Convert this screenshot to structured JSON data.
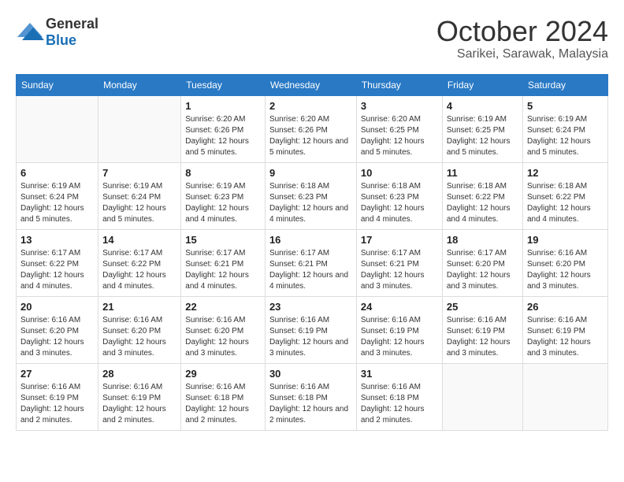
{
  "header": {
    "logo_general": "General",
    "logo_blue": "Blue",
    "month_year": "October 2024",
    "location": "Sarikei, Sarawak, Malaysia"
  },
  "days_of_week": [
    "Sunday",
    "Monday",
    "Tuesday",
    "Wednesday",
    "Thursday",
    "Friday",
    "Saturday"
  ],
  "weeks": [
    [
      null,
      null,
      {
        "day": 1,
        "sunrise": "Sunrise: 6:20 AM",
        "sunset": "Sunset: 6:26 PM",
        "daylight": "Daylight: 12 hours and 5 minutes."
      },
      {
        "day": 2,
        "sunrise": "Sunrise: 6:20 AM",
        "sunset": "Sunset: 6:26 PM",
        "daylight": "Daylight: 12 hours and 5 minutes."
      },
      {
        "day": 3,
        "sunrise": "Sunrise: 6:20 AM",
        "sunset": "Sunset: 6:25 PM",
        "daylight": "Daylight: 12 hours and 5 minutes."
      },
      {
        "day": 4,
        "sunrise": "Sunrise: 6:19 AM",
        "sunset": "Sunset: 6:25 PM",
        "daylight": "Daylight: 12 hours and 5 minutes."
      },
      {
        "day": 5,
        "sunrise": "Sunrise: 6:19 AM",
        "sunset": "Sunset: 6:24 PM",
        "daylight": "Daylight: 12 hours and 5 minutes."
      }
    ],
    [
      {
        "day": 6,
        "sunrise": "Sunrise: 6:19 AM",
        "sunset": "Sunset: 6:24 PM",
        "daylight": "Daylight: 12 hours and 5 minutes."
      },
      {
        "day": 7,
        "sunrise": "Sunrise: 6:19 AM",
        "sunset": "Sunset: 6:24 PM",
        "daylight": "Daylight: 12 hours and 5 minutes."
      },
      {
        "day": 8,
        "sunrise": "Sunrise: 6:19 AM",
        "sunset": "Sunset: 6:23 PM",
        "daylight": "Daylight: 12 hours and 4 minutes."
      },
      {
        "day": 9,
        "sunrise": "Sunrise: 6:18 AM",
        "sunset": "Sunset: 6:23 PM",
        "daylight": "Daylight: 12 hours and 4 minutes."
      },
      {
        "day": 10,
        "sunrise": "Sunrise: 6:18 AM",
        "sunset": "Sunset: 6:23 PM",
        "daylight": "Daylight: 12 hours and 4 minutes."
      },
      {
        "day": 11,
        "sunrise": "Sunrise: 6:18 AM",
        "sunset": "Sunset: 6:22 PM",
        "daylight": "Daylight: 12 hours and 4 minutes."
      },
      {
        "day": 12,
        "sunrise": "Sunrise: 6:18 AM",
        "sunset": "Sunset: 6:22 PM",
        "daylight": "Daylight: 12 hours and 4 minutes."
      }
    ],
    [
      {
        "day": 13,
        "sunrise": "Sunrise: 6:17 AM",
        "sunset": "Sunset: 6:22 PM",
        "daylight": "Daylight: 12 hours and 4 minutes."
      },
      {
        "day": 14,
        "sunrise": "Sunrise: 6:17 AM",
        "sunset": "Sunset: 6:22 PM",
        "daylight": "Daylight: 12 hours and 4 minutes."
      },
      {
        "day": 15,
        "sunrise": "Sunrise: 6:17 AM",
        "sunset": "Sunset: 6:21 PM",
        "daylight": "Daylight: 12 hours and 4 minutes."
      },
      {
        "day": 16,
        "sunrise": "Sunrise: 6:17 AM",
        "sunset": "Sunset: 6:21 PM",
        "daylight": "Daylight: 12 hours and 4 minutes."
      },
      {
        "day": 17,
        "sunrise": "Sunrise: 6:17 AM",
        "sunset": "Sunset: 6:21 PM",
        "daylight": "Daylight: 12 hours and 3 minutes."
      },
      {
        "day": 18,
        "sunrise": "Sunrise: 6:17 AM",
        "sunset": "Sunset: 6:20 PM",
        "daylight": "Daylight: 12 hours and 3 minutes."
      },
      {
        "day": 19,
        "sunrise": "Sunrise: 6:16 AM",
        "sunset": "Sunset: 6:20 PM",
        "daylight": "Daylight: 12 hours and 3 minutes."
      }
    ],
    [
      {
        "day": 20,
        "sunrise": "Sunrise: 6:16 AM",
        "sunset": "Sunset: 6:20 PM",
        "daylight": "Daylight: 12 hours and 3 minutes."
      },
      {
        "day": 21,
        "sunrise": "Sunrise: 6:16 AM",
        "sunset": "Sunset: 6:20 PM",
        "daylight": "Daylight: 12 hours and 3 minutes."
      },
      {
        "day": 22,
        "sunrise": "Sunrise: 6:16 AM",
        "sunset": "Sunset: 6:20 PM",
        "daylight": "Daylight: 12 hours and 3 minutes."
      },
      {
        "day": 23,
        "sunrise": "Sunrise: 6:16 AM",
        "sunset": "Sunset: 6:19 PM",
        "daylight": "Daylight: 12 hours and 3 minutes."
      },
      {
        "day": 24,
        "sunrise": "Sunrise: 6:16 AM",
        "sunset": "Sunset: 6:19 PM",
        "daylight": "Daylight: 12 hours and 3 minutes."
      },
      {
        "day": 25,
        "sunrise": "Sunrise: 6:16 AM",
        "sunset": "Sunset: 6:19 PM",
        "daylight": "Daylight: 12 hours and 3 minutes."
      },
      {
        "day": 26,
        "sunrise": "Sunrise: 6:16 AM",
        "sunset": "Sunset: 6:19 PM",
        "daylight": "Daylight: 12 hours and 3 minutes."
      }
    ],
    [
      {
        "day": 27,
        "sunrise": "Sunrise: 6:16 AM",
        "sunset": "Sunset: 6:19 PM",
        "daylight": "Daylight: 12 hours and 2 minutes."
      },
      {
        "day": 28,
        "sunrise": "Sunrise: 6:16 AM",
        "sunset": "Sunset: 6:19 PM",
        "daylight": "Daylight: 12 hours and 2 minutes."
      },
      {
        "day": 29,
        "sunrise": "Sunrise: 6:16 AM",
        "sunset": "Sunset: 6:18 PM",
        "daylight": "Daylight: 12 hours and 2 minutes."
      },
      {
        "day": 30,
        "sunrise": "Sunrise: 6:16 AM",
        "sunset": "Sunset: 6:18 PM",
        "daylight": "Daylight: 12 hours and 2 minutes."
      },
      {
        "day": 31,
        "sunrise": "Sunrise: 6:16 AM",
        "sunset": "Sunset: 6:18 PM",
        "daylight": "Daylight: 12 hours and 2 minutes."
      },
      null,
      null
    ]
  ]
}
